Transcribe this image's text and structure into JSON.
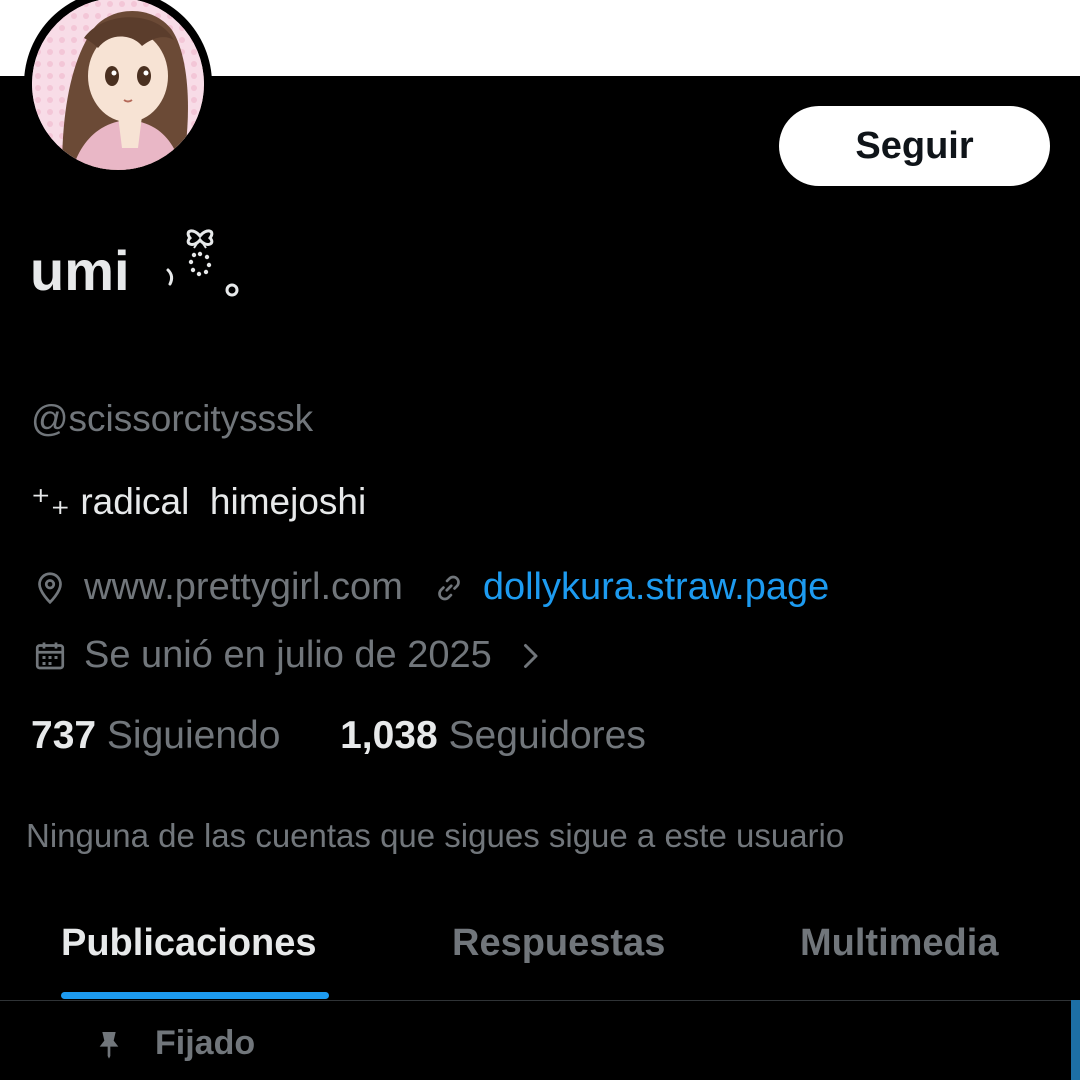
{
  "profile": {
    "display_name": "umi",
    "handle": "@scissorcitysssk",
    "bio_prefix": "⁺₊",
    "bio": "radical  himejoshi",
    "location": "www.prettygirl.com",
    "website": "dollykura.straw.page",
    "joined": "Se unió en julio de 2025",
    "following_count": "737",
    "following_label": "Siguiendo",
    "followers_count": "1,038",
    "followers_label": "Seguidores",
    "mutual_note": "Ninguna de las cuentas que sigues sigue a este usuario"
  },
  "actions": {
    "follow_label": "Seguir"
  },
  "tabs": [
    {
      "label": "Publicaciones",
      "active": true
    },
    {
      "label": "Respuestas",
      "active": false
    },
    {
      "label": "Multimedia",
      "active": false
    }
  ],
  "pinned": {
    "label": "Fijado"
  },
  "icons": {
    "location": "location-pin-icon",
    "link": "link-icon",
    "calendar": "calendar-icon",
    "chevron": "chevron-right-icon",
    "pin": "pin-icon"
  },
  "colors": {
    "background": "#000000",
    "text_primary": "#e7e9ea",
    "text_secondary": "#71767b",
    "accent": "#1d9bf0",
    "banner": "#ffffff"
  }
}
